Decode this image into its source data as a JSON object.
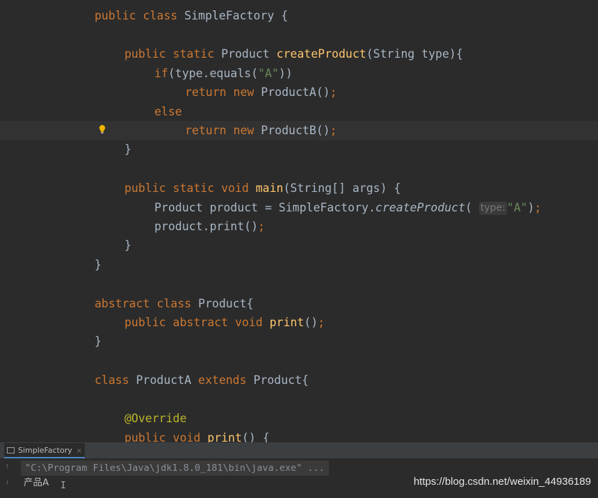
{
  "editor": {
    "lines": {
      "l1": {
        "kw1": "public class ",
        "name": "SimpleFactory {"
      },
      "l3": {
        "kw1": "public static ",
        "type": "Product ",
        "fn": "createProduct",
        "args": "(String type){"
      },
      "l4": {
        "kw1": "if",
        "pre": "(type.equals(",
        "str": "\"A\"",
        "post": "))"
      },
      "l5": {
        "kw1": "return new ",
        "call": "ProductA()",
        "semi": ";"
      },
      "l6": {
        "kw1": "else"
      },
      "l7": {
        "kw1": "return new ",
        "call": "ProductB()",
        "semi": ";"
      },
      "l8": {
        "text": "}"
      },
      "l10": {
        "kw1": "public static void ",
        "fn": "main",
        "args": "(String[] args) {"
      },
      "l11": {
        "pre": "Product product = SimpleFactory.",
        "call": "createProduct",
        "open": "( ",
        "hint": "type:",
        "str": "\"A\"",
        "close": ")",
        "semi": ";"
      },
      "l12": {
        "pre": "product.print()",
        "semi": ";"
      },
      "l13": {
        "text": "}"
      },
      "l14": {
        "text": "}"
      },
      "l16": {
        "kw1": "abstract class ",
        "name": "Product{"
      },
      "l17": {
        "kw1": "public abstract void ",
        "fn": "print",
        "args": "()",
        "semi": ";"
      },
      "l18": {
        "text": "}"
      },
      "l20": {
        "kw1": "class ",
        "name": "ProductA ",
        "kw2": "extends ",
        "name2": "Product{"
      },
      "l22": {
        "ann": "@Override"
      },
      "l23": {
        "kw1": "public void ",
        "fn": "print",
        "args": "() {"
      }
    }
  },
  "console": {
    "tab_label": "SimpleFactory",
    "tab_close": "×",
    "command": "\"C:\\Program Files\\Java\\jdk1.8.0_181\\bin\\java.exe\" ...",
    "output": "产品A",
    "gutter_up": "↑",
    "gutter_down": "↓",
    "cursor": "I"
  },
  "watermark": "https://blog.csdn.net/weixin_44936189",
  "colors": {
    "background": "#2b2b2b",
    "keyword": "#cc7832",
    "function": "#ffc66d",
    "string": "#6a8759",
    "annotation": "#bbb529",
    "text": "#a9b7c6"
  }
}
